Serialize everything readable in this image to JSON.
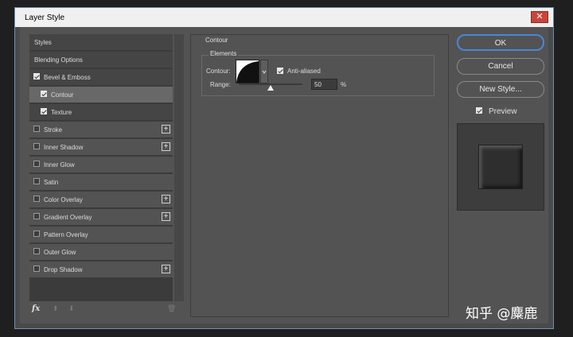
{
  "window": {
    "title": "Layer Style",
    "close_glyph": "✕"
  },
  "sidebar": {
    "items": [
      {
        "label": "Styles",
        "checkbox": false,
        "checked": false,
        "plus": false
      },
      {
        "label": "Blending Options",
        "checkbox": false,
        "checked": false,
        "plus": false
      },
      {
        "label": "Bevel & Emboss",
        "checkbox": true,
        "checked": true,
        "plus": false
      },
      {
        "label": "Contour",
        "checkbox": true,
        "checked": true,
        "plus": false
      },
      {
        "label": "Texture",
        "checkbox": true,
        "checked": true,
        "plus": false
      },
      {
        "label": "Stroke",
        "checkbox": true,
        "checked": false,
        "plus": true
      },
      {
        "label": "Inner Shadow",
        "checkbox": true,
        "checked": false,
        "plus": true
      },
      {
        "label": "Inner Glow",
        "checkbox": true,
        "checked": false,
        "plus": false
      },
      {
        "label": "Satin",
        "checkbox": true,
        "checked": false,
        "plus": false
      },
      {
        "label": "Color Overlay",
        "checkbox": true,
        "checked": false,
        "plus": true
      },
      {
        "label": "Gradient Overlay",
        "checkbox": true,
        "checked": false,
        "plus": true
      },
      {
        "label": "Pattern Overlay",
        "checkbox": true,
        "checked": false,
        "plus": false
      },
      {
        "label": "Outer Glow",
        "checkbox": true,
        "checked": false,
        "plus": false
      },
      {
        "label": "Drop Shadow",
        "checkbox": true,
        "checked": false,
        "plus": true
      }
    ],
    "plus_glyph": "+",
    "fx_label": "fx",
    "up_glyph": "⬆",
    "down_glyph": "⬇",
    "trash_glyph": "🗑"
  },
  "contour_panel": {
    "section_title": "Contour",
    "group_title": "Elements",
    "contour_label": "Contour:",
    "anti_aliased_label": "Anti-aliased",
    "anti_aliased_checked": true,
    "range_label": "Range:",
    "range_value": "50",
    "range_unit": "%",
    "range_fraction": 0.5
  },
  "buttons": {
    "ok": "OK",
    "cancel": "Cancel",
    "new_style": "New Style...",
    "preview_label": "Preview",
    "preview_checked": true
  },
  "watermark": "知乎 @麋鹿",
  "colors": {
    "accent": "#4b86d6",
    "selected_row": "#686868",
    "window_border": "#6d8fb5"
  }
}
